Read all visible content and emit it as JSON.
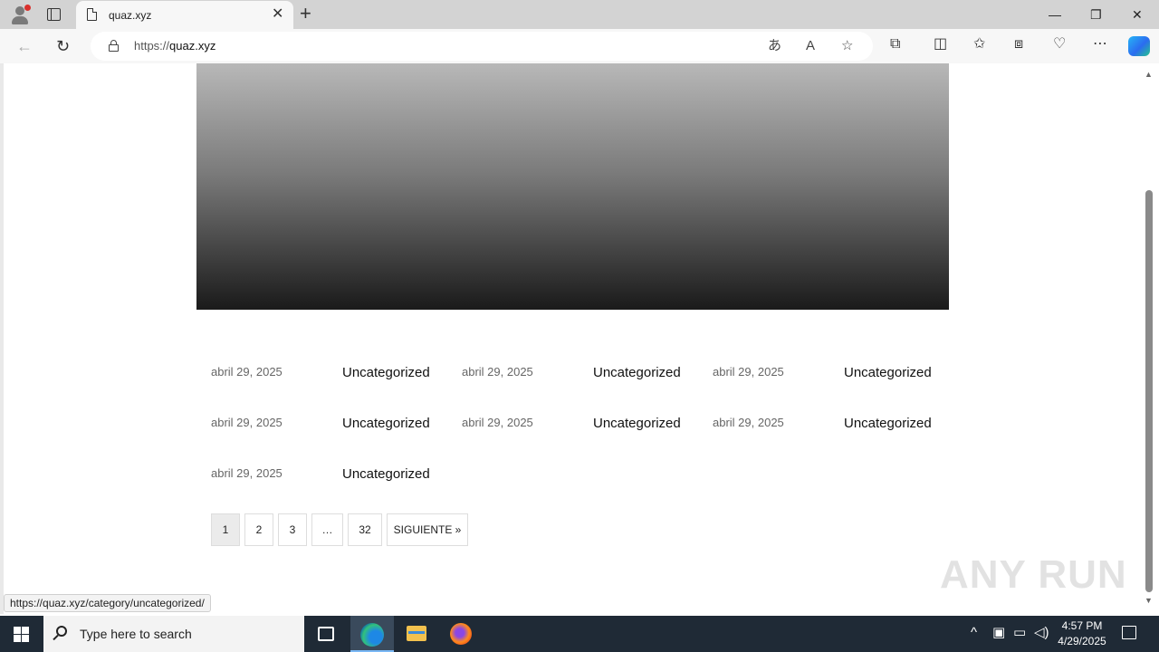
{
  "browser": {
    "tab_title": "quaz.xyz",
    "url_scheme": "https://",
    "url_host": "quaz.xyz",
    "status_url": "https://quaz.xyz/category/uncategorized/"
  },
  "posts": [
    {
      "date": "abril 29, 2025",
      "category": "Uncategorized"
    },
    {
      "date": "abril 29, 2025",
      "category": "Uncategorized"
    },
    {
      "date": "abril 29, 2025",
      "category": "Uncategorized"
    },
    {
      "date": "abril 29, 2025",
      "category": "Uncategorized"
    },
    {
      "date": "abril 29, 2025",
      "category": "Uncategorized"
    },
    {
      "date": "abril 29, 2025",
      "category": "Uncategorized"
    },
    {
      "date": "abril 29, 2025",
      "category": "Uncategorized"
    }
  ],
  "pagination": {
    "pages": [
      "1",
      "2",
      "3",
      "…",
      "32"
    ],
    "current": "1",
    "next_label": "SIGUIENTE »"
  },
  "watermark": "ANY RUN",
  "taskbar": {
    "search_placeholder": "Type here to search",
    "time": "4:57 PM",
    "date": "4/29/2025"
  },
  "colors": {
    "taskbar_bg": "#1f2a36",
    "tab_strip_bg": "#d3d3d3",
    "toolbar_bg": "#f7f7f7"
  }
}
